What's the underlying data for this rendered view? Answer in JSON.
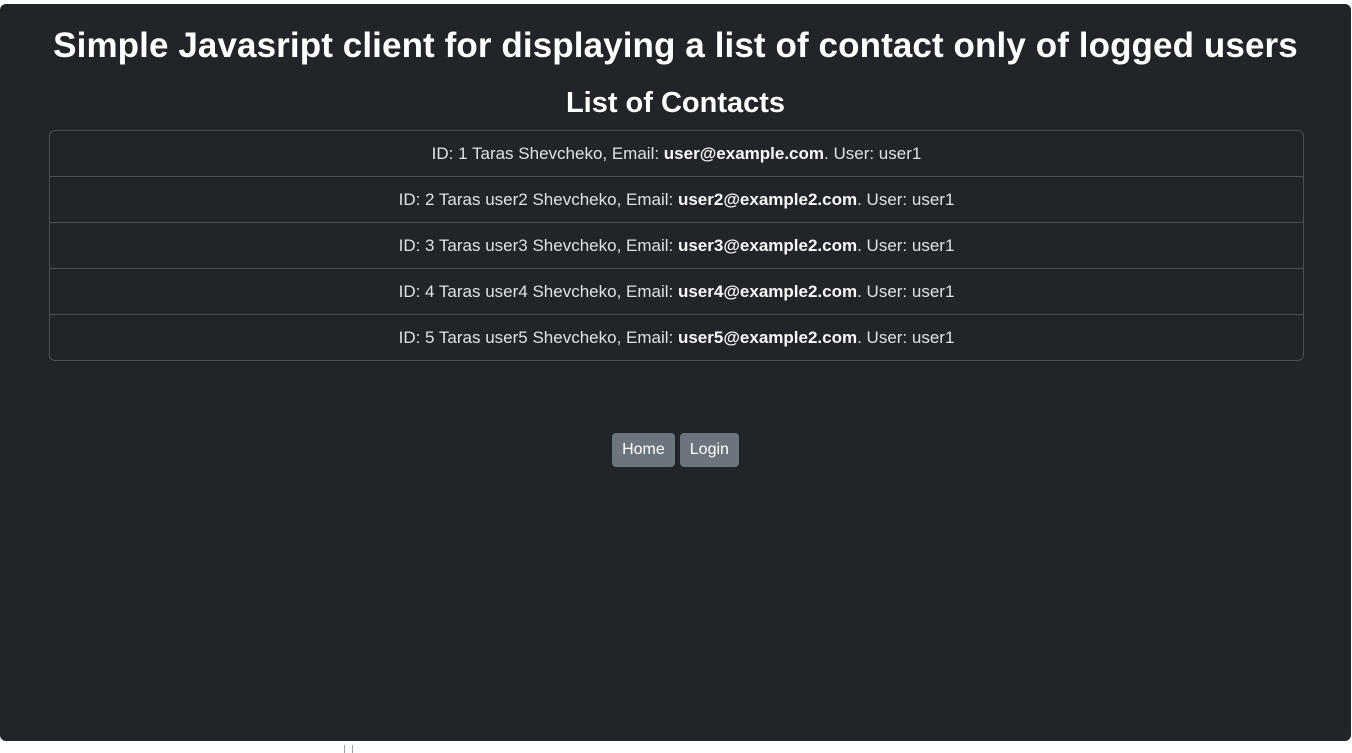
{
  "header": {
    "title": "Simple Javasript client for displaying a list of contact only of logged users",
    "subtitle": "List of Contacts"
  },
  "contacts": [
    {
      "prefix": "ID: 1 Taras Shevcheko, Email: ",
      "email": "user@example.com",
      "suffix": ". User: user1"
    },
    {
      "prefix": "ID: 2 Taras user2 Shevcheko, Email: ",
      "email": "user2@example2.com",
      "suffix": ". User: user1"
    },
    {
      "prefix": "ID: 3 Taras user3 Shevcheko, Email: ",
      "email": "user3@example2.com",
      "suffix": ". User: user1"
    },
    {
      "prefix": "ID: 4 Taras user4 Shevcheko, Email: ",
      "email": "user4@example2.com",
      "suffix": ". User: user1"
    },
    {
      "prefix": "ID: 5 Taras user5 Shevcheko, Email: ",
      "email": "user5@example2.com",
      "suffix": ". User: user1"
    }
  ],
  "nav": {
    "home_label": "Home",
    "login_label": "Login"
  },
  "colors": {
    "background": "#212529",
    "button": "#6c757d",
    "border": "#495057"
  }
}
